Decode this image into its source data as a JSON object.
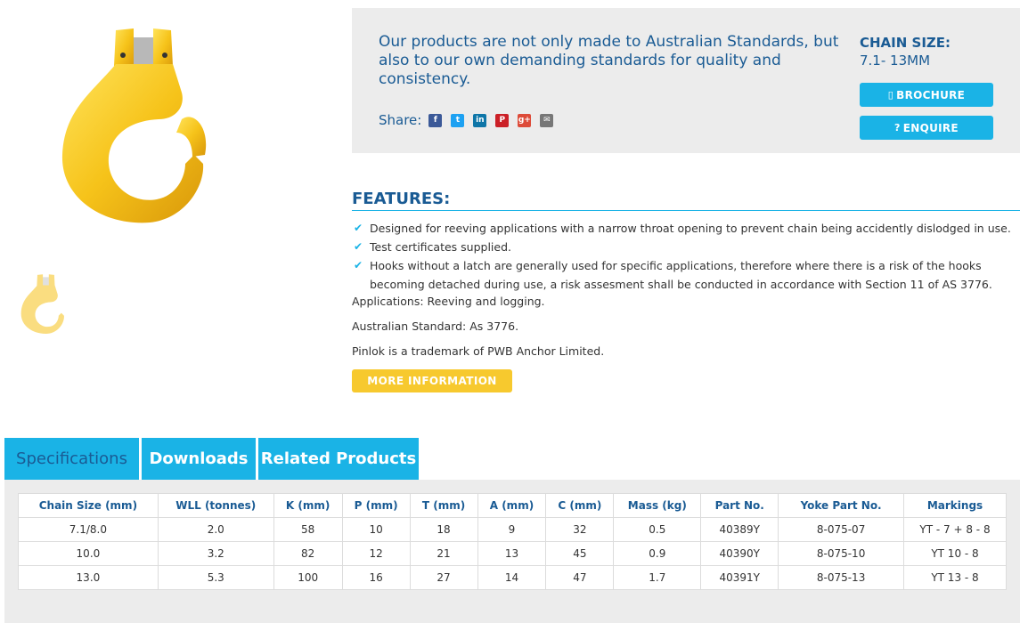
{
  "info": {
    "tagline": "Our products are not only made to Australian Standards, but also to our own demanding standards for quality and consistency.",
    "share_label": "Share:",
    "share_icons": [
      "facebook-icon",
      "twitter-icon",
      "linkedin-icon",
      "pinterest-icon",
      "google-plus-icon",
      "email-icon"
    ],
    "chain_size_label": "CHAIN SIZE:",
    "chain_size_value": "7.1- 13MM",
    "brochure_label": "BROCHURE",
    "enquire_label": "ENQUIRE"
  },
  "features": {
    "title": "FEATURES:",
    "items": [
      "Designed for reeving applications with a narrow throat opening to prevent chain being accidently dislodged in use.",
      "Test certificates supplied.",
      "Hooks without a latch are generally used for specific applications, therefore where there is a risk of the hooks becoming detached during use, a risk assesment shall be conducted in accordance with Section 11 of AS 3776."
    ],
    "applications": "Applications: Reeving and logging.",
    "standard": "Australian Standard: As 3776.",
    "trademark": "Pinlok is a trademark of PWB Anchor Limited.",
    "more_label": "MORE INFORMATION"
  },
  "tabs": {
    "specifications": "Specifications",
    "downloads": "Downloads",
    "related": "Related Products"
  },
  "spec_table": {
    "headers": [
      "Chain Size (mm)",
      "WLL (tonnes)",
      "K (mm)",
      "P (mm)",
      "T (mm)",
      "A (mm)",
      "C (mm)",
      "Mass (kg)",
      "Part No.",
      "Yoke Part No.",
      "Markings"
    ],
    "rows": [
      [
        "7.1/8.0",
        "2.0",
        "58",
        "10",
        "18",
        "9",
        "32",
        "0.5",
        "40389Y",
        "8-075-07",
        "YT - 7 + 8 - 8"
      ],
      [
        "10.0",
        "3.2",
        "82",
        "12",
        "21",
        "13",
        "45",
        "0.9",
        "40390Y",
        "8-075-10",
        "YT 10 - 8"
      ],
      [
        "13.0",
        "5.3",
        "100",
        "16",
        "27",
        "14",
        "47",
        "1.7",
        "40391Y",
        "8-075-13",
        "YT 13 - 8"
      ]
    ]
  },
  "colors": {
    "brand_blue": "#1a5b94",
    "accent_cyan": "#1ab3e6",
    "accent_yellow": "#f7c92e",
    "panel_grey": "#ececec"
  }
}
